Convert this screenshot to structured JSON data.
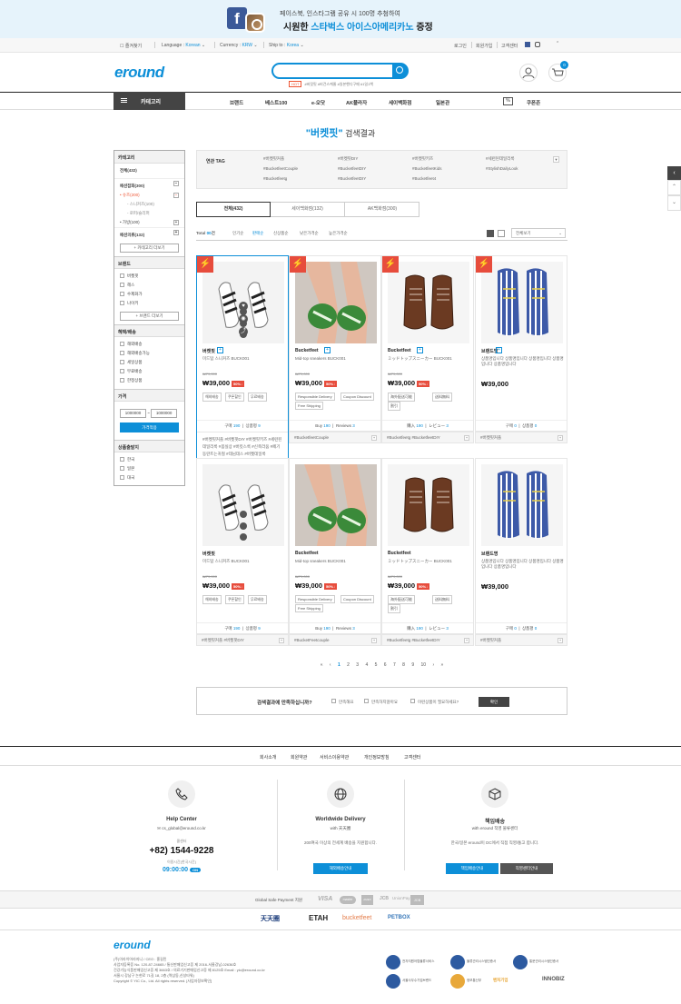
{
  "banner": {
    "line1": "페이스북, 인스타그램 공유 시 100명 추첨하여",
    "line2_pre": "시원한 ",
    "line2_em": "스타벅스 아이스아메리카노",
    "line2_post": " 증정"
  },
  "topbar": {
    "bookmark": "즐겨찾기",
    "language_label": "Language :",
    "language": "Korean",
    "currency_label": "Currency :",
    "currency": "KRW",
    "ship_label": "Ship to :",
    "ship": "Korea",
    "login": "로그인",
    "join": "회원가입",
    "cs": "고객센터"
  },
  "header": {
    "logo": "eround",
    "hot": "HOT",
    "tags": "#버킷핏 #비건스케줄 #일본핸디구매 #1일1백",
    "cart_count": "0"
  },
  "nav": {
    "category": "카테고리",
    "items": [
      "브랜드",
      "베스트100",
      "e-오닷",
      "AK플라자",
      "세이백화점",
      "일본관"
    ],
    "coupon": "쿠폰존",
    "coupon_icon": "%"
  },
  "search_title": {
    "keyword": "\"버켓핏\"",
    "suffix": " 검색결과"
  },
  "sidebar": {
    "category_head": "카테고리",
    "all": "전체(432)",
    "fashion": "패션잡화(300)",
    "shoes": "• 슈즈(200)",
    "sneakers": "- 스니커즈(100)",
    "loafers": "- 로퍼/슬리퍼",
    "bag": "• 가방(100)",
    "fashion_clothes": "패션의류(132)",
    "more_cat": "+ 카테고리 더보기",
    "brand_head": "브랜드",
    "brands": [
      "버켓핏",
      "헤스",
      "수제화가",
      "나이키"
    ],
    "more_brand": "+ 브랜드 더보기",
    "benefit_head": "혜택/배송",
    "benefits": [
      "해외배송",
      "해외배송가능",
      "세일상품",
      "무료배송",
      "한정상품"
    ],
    "price_head": "가격",
    "price_min": "1000000",
    "price_sep": "~",
    "price_max": "1000000",
    "price_apply": "가격적용",
    "origin_head": "상품출발지",
    "origins": [
      "한국",
      "일본",
      "대국"
    ]
  },
  "tagbox": {
    "label": "연관 TAG",
    "tags": [
      "#버켓핏커플",
      "#버켓핏DIY",
      "#버켓핏키즈",
      "#세련된데일리룩",
      "#BucketfeetCouple",
      "#BucketfeetDIY",
      "#BucketfeetKids",
      "#StylishDailyLook",
      "#Bucketfeetg",
      "#BucketfeetDIY",
      "#Bucketfeet4"
    ]
  },
  "tabs": [
    "전체(432)",
    "세이백화점(132)",
    "AK백화점(300)"
  ],
  "sort": {
    "total_label": "Total ",
    "total": "00",
    "total_unit": "건",
    "options": [
      "인기순",
      "판매순",
      "신상품순",
      "낮은가격순",
      "높은가격순"
    ],
    "perpage": "전체보기"
  },
  "products": [
    {
      "name": "버켓핏",
      "desc": "미드탑 스니커즈 BUCK001",
      "orig": "₩79,000",
      "price": "₩39,000",
      "pct": "50%↓",
      "badges": [
        "해외배송",
        "쿠폰할인",
        "무료배송"
      ],
      "stat_a_label": "구매 ",
      "stat_a": "190",
      "stat_b_label": "상품평 ",
      "stat_b": "9",
      "tags": "#버켓핏커플 #버켓핏DIY #버켓핏키즈 #세련된데일리룩 #봄실상 #버킷스룩 #신축라움 #페기동란트는귀철 #데님데스 #버켓데일룩"
    },
    {
      "name": "Bucketfeet",
      "desc": "Mid-top sneakers BUCK001",
      "orig": "₩79,000",
      "price": "₩39,000",
      "pct": "50%↓",
      "badges": [
        "Responsible Delivery",
        "Coupon Discount",
        "Free Shipping"
      ],
      "stat_a_label": "Buy ",
      "stat_a": "190",
      "stat_b_label": "Reviews ",
      "stat_b": "3",
      "tags": "#BucketfeetCouple"
    },
    {
      "name": "Bucketfeet",
      "desc": "ミッドトップスニーカー BUCK001",
      "orig": "₩79,000",
      "price": "₩39,000",
      "pct": "50%↓",
      "badges": [
        "海外配送可能",
        "送料無料",
        "割引"
      ],
      "stat_a_label": "購入 ",
      "stat_a": "190",
      "stat_b_label": "レビュー ",
      "stat_b": "3",
      "tags": "#Bucketfeetg  #BucketfeetDIY"
    },
    {
      "name": "브랜드명",
      "desc": "상품명입니다 상품명입니다 상품명입니다 상품명입니다 상품명입니다",
      "orig": "",
      "price": "₩39,000",
      "pct": "",
      "badges": [],
      "stat_a_label": "구매 ",
      "stat_a": "0",
      "stat_b_label": "상품평 ",
      "stat_b": "0",
      "tags": "#버켓핏커플"
    },
    {
      "name": "버켓핏",
      "desc": "미드탑 스니커즈 BUCK001",
      "orig": "₩79,000",
      "price": "₩39,000",
      "pct": "50%↓",
      "badges": [
        "해외배송",
        "쿠폰할인",
        "무료배송"
      ],
      "stat_a_label": "구매 ",
      "stat_a": "190",
      "stat_b_label": "상품평 ",
      "stat_b": "9",
      "tags": "#버켓핏커플  #버켓핏DIY"
    },
    {
      "name": "Bucketfeet",
      "desc": "Mid-top sneakers BUCK001",
      "orig": "₩79,000",
      "price": "₩39,000",
      "pct": "50%↓",
      "badges": [
        "Responsible Delivery",
        "Coupon Discount",
        "Free Shipping"
      ],
      "stat_a_label": "Buy ",
      "stat_a": "190",
      "stat_b_label": "Reviews ",
      "stat_b": "3",
      "tags": "#BucketFeetcouple"
    },
    {
      "name": "Bucketfeet",
      "desc": "ミッドトップスニーカー BUCK001",
      "orig": "₩79,000",
      "price": "₩39,000",
      "pct": "50%↓",
      "badges": [
        "海外配送可能",
        "送料無料",
        "割引"
      ],
      "stat_a_label": "購入 ",
      "stat_a": "190",
      "stat_b_label": "レビュー ",
      "stat_b": "3",
      "tags": "#Bucketfeetg  #BucketfeetDIY"
    },
    {
      "name": "브랜드명",
      "desc": "상품명입니다 상품명입니다 상품명입니다 상품명입니다 상품명입니다",
      "orig": "",
      "price": "₩39,000",
      "pct": "",
      "badges": [],
      "stat_a_label": "구매 ",
      "stat_a": "0",
      "stat_b_label": "상품평 ",
      "stat_b": "0",
      "tags": "#버켓핏커플"
    }
  ],
  "pager": {
    "first": "«",
    "prev": "‹",
    "pages": [
      "1",
      "2",
      "3",
      "4",
      "5",
      "6",
      "7",
      "8",
      "9",
      "10"
    ],
    "next": "›",
    "last": "»"
  },
  "survey": {
    "question": "검색결과에 만족하십니까?",
    "opt1": "만족해요",
    "opt2": "만족하지않아요",
    "opt3": "이런상품이 필요하세요?",
    "confirm": "확인"
  },
  "footer": {
    "links": [
      "회사소개",
      "회원약관",
      "서비스이용약관",
      "개인정보방침",
      "고객센터"
    ],
    "help_title": "Help Center",
    "help_email": "cs_global@eround.co.kr",
    "help_phone_label": "콜센터",
    "help_phone": "+82) 1544-9228",
    "help_hours_label": "이용시간(한국시간)",
    "help_hours": "09:00:00",
    "help_on": "ON",
    "world_title": "Worldwide Delivery",
    "world_sub": "with 天天圈",
    "world_desc": "200여국 이상의 전세계 배송을 지원합니다.",
    "world_btn": "해외배송안내",
    "resp_title": "책임배송",
    "resp_sub": "with eround 직영 물류센터",
    "resp_desc": "한국/일본 eround이 DC에서 직접 직영/통고 합니다.",
    "resp_btn1": "책임배송안내",
    "resp_btn2": "직영센터안내",
    "pay_label": "Global Safe Payment 지원",
    "pay_logos": [
      "VISA",
      "master",
      "AMEX",
      "JCB",
      "UnionPay",
      "JCB"
    ],
    "partners": [
      "天天圈",
      "ETAH",
      "bucketfeet",
      "PETBOX"
    ],
    "corp_logo": "eround",
    "corp_lines": [
      "(주)이라이어라지니 / CEO : 홍길민",
      "사업자등록증 No. 120-87-24665 / 통신판매업신고증 제 2016-서울강남-02636호",
      "건강기능식품판매업신고증 제 3663호 / 의료기기판매업신고증 제 8125호 Email : yic@eround.co.kr",
      "서울시 강남구 논현로 71길 18, 2층 (역삼동,신성타워)",
      "Copyright © YIC Co., Ltd. All rights reserved. [사업자정보확인]"
    ],
    "certs": [
      "전자지원어렵물류서비스",
      "물류관리시스템인증서",
      "통문관리시스템인증서",
      "서울사무수기업브랜드",
      "정보통신부",
      "벤처기업",
      "INNOBIZ"
    ]
  }
}
